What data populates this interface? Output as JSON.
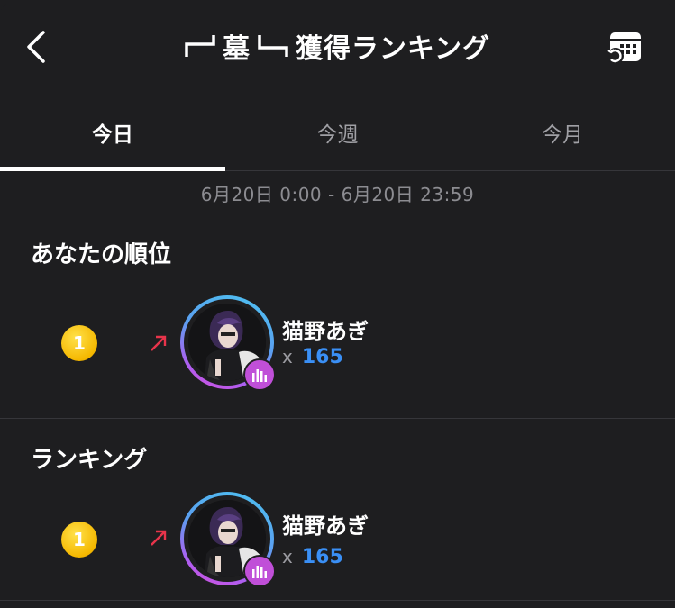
{
  "header": {
    "title": "墓",
    "title_suffix": "獲得ランキング"
  },
  "tabs": [
    {
      "label": "今日",
      "active": true
    },
    {
      "label": "今週",
      "active": false
    },
    {
      "label": "今月",
      "active": false
    }
  ],
  "date_range": "6月20日 0:00 - 6月20日 23:59",
  "my_rank": {
    "section_title": "あなたの順位",
    "rank": "1",
    "trend": "up",
    "name": "猫野あぎ",
    "score_prefix": "x",
    "score": "165"
  },
  "ranking": {
    "section_title": "ランキング",
    "items": [
      {
        "rank": "1",
        "trend": "up",
        "name": "猫野あぎ",
        "score_prefix": "x",
        "score": "165"
      }
    ]
  },
  "colors": {
    "background": "#1e1e20",
    "accent_blue": "#3a8ff5",
    "trend_up": "#e8344b",
    "badge_gold": "#f5b800",
    "live_badge": "#c04fd8"
  }
}
